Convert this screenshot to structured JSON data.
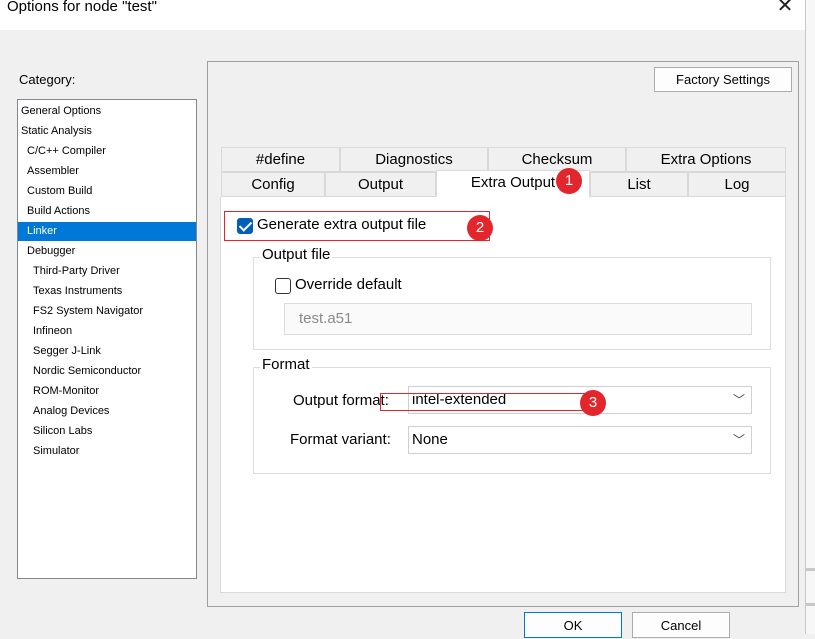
{
  "window": {
    "title": "Options for node \"test\"",
    "close_icon": "close-icon"
  },
  "category": {
    "label": "Category:",
    "items": [
      {
        "label": "General Options",
        "indent": 0
      },
      {
        "label": "Static Analysis",
        "indent": 0
      },
      {
        "label": "C/C++ Compiler",
        "indent": 1
      },
      {
        "label": "Assembler",
        "indent": 1
      },
      {
        "label": "Custom Build",
        "indent": 1
      },
      {
        "label": "Build Actions",
        "indent": 1
      },
      {
        "label": "Linker",
        "indent": 1,
        "selected": true
      },
      {
        "label": "Debugger",
        "indent": 1
      },
      {
        "label": "Third-Party Driver",
        "indent": 2
      },
      {
        "label": "Texas Instruments",
        "indent": 2
      },
      {
        "label": "FS2 System Navigator",
        "indent": 2
      },
      {
        "label": "Infineon",
        "indent": 2
      },
      {
        "label": "Segger J-Link",
        "indent": 2
      },
      {
        "label": "Nordic Semiconductor",
        "indent": 2
      },
      {
        "label": "ROM-Monitor",
        "indent": 2
      },
      {
        "label": "Analog Devices",
        "indent": 2
      },
      {
        "label": "Silicon Labs",
        "indent": 2
      },
      {
        "label": "Simulator",
        "indent": 2
      }
    ]
  },
  "factory_settings_label": "Factory Settings",
  "tabs": {
    "row_top": [
      "#define",
      "Diagnostics",
      "Checksum",
      "Extra Options"
    ],
    "row_bottom": [
      "Config",
      "Output",
      "Extra Output",
      "List",
      "Log"
    ],
    "active": "Extra Output"
  },
  "extra_output": {
    "generate_label": "Generate extra output file",
    "generate_checked": true,
    "output_file_group": "Output file",
    "override_label": "Override default",
    "override_checked": false,
    "filename_value": "test.a51",
    "format_group": "Format",
    "output_format_label": "Output format:",
    "output_format_value": "intel-extended",
    "format_variant_label": "Format variant:",
    "format_variant_value": "None"
  },
  "annotations": [
    "1",
    "2",
    "3"
  ],
  "buttons": {
    "ok": "OK",
    "cancel": "Cancel"
  },
  "colors": {
    "accent": "#0078d7",
    "annotation": "#e3262b"
  }
}
